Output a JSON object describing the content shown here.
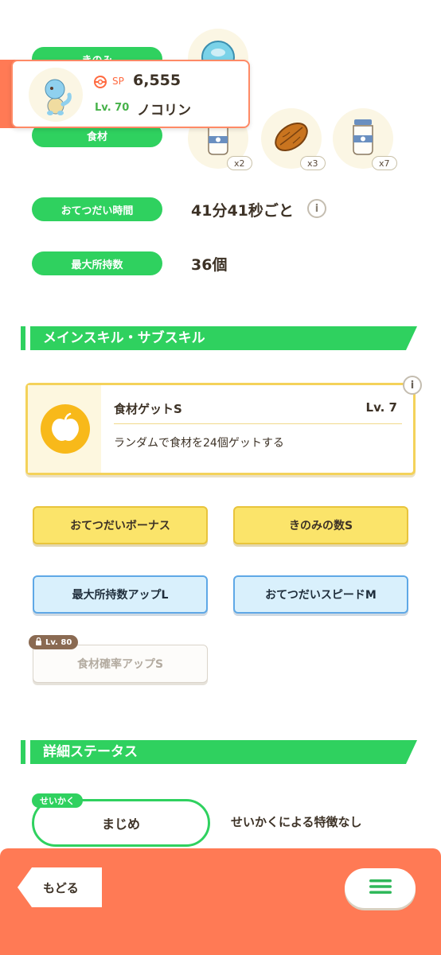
{
  "profile": {
    "sp_label": "SP",
    "sp_value": "6,555",
    "level": "Lv. 70",
    "name": "ノコリン"
  },
  "stats": {
    "berry_label": "きのみ",
    "ingredient_label": "食材",
    "ingredients": [
      {
        "icon": "milk-bottle-icon",
        "qty": "x2"
      },
      {
        "icon": "cacao-bean-icon",
        "qty": "x3"
      },
      {
        "icon": "milk-bottle-icon",
        "qty": "x7"
      }
    ],
    "help_time_label": "おてつだい時間",
    "help_time_value": "41分41秒ごと",
    "max_carry_label": "最大所持数",
    "max_carry_value": "36個"
  },
  "skills_section": {
    "title": "メインスキル・サブスキル",
    "main_skill": {
      "name": "食材ゲットS",
      "level": "Lv. 7",
      "description": "ランダムで食材を24個ゲットする"
    },
    "sub_skills": [
      {
        "label": "おてつだいボーナス",
        "style": "gold"
      },
      {
        "label": "きのみの数S",
        "style": "gold"
      },
      {
        "label": "最大所持数アップL",
        "style": "blue"
      },
      {
        "label": "おてつだいスピードM",
        "style": "blue"
      },
      {
        "label": "食材確率アップS",
        "style": "locked",
        "lock_level": "Lv. 80"
      }
    ]
  },
  "details_section": {
    "title": "詳細ステータス",
    "nature_tag": "せいかく",
    "nature_value": "まじめ",
    "nature_effect": "せいかくによる特徴なし"
  },
  "footer": {
    "back_label": "もどる"
  },
  "colors": {
    "green": "#2fd15f",
    "orange": "#ff7a55",
    "gold": "#fbe46a",
    "blue": "#d9f0fc"
  }
}
